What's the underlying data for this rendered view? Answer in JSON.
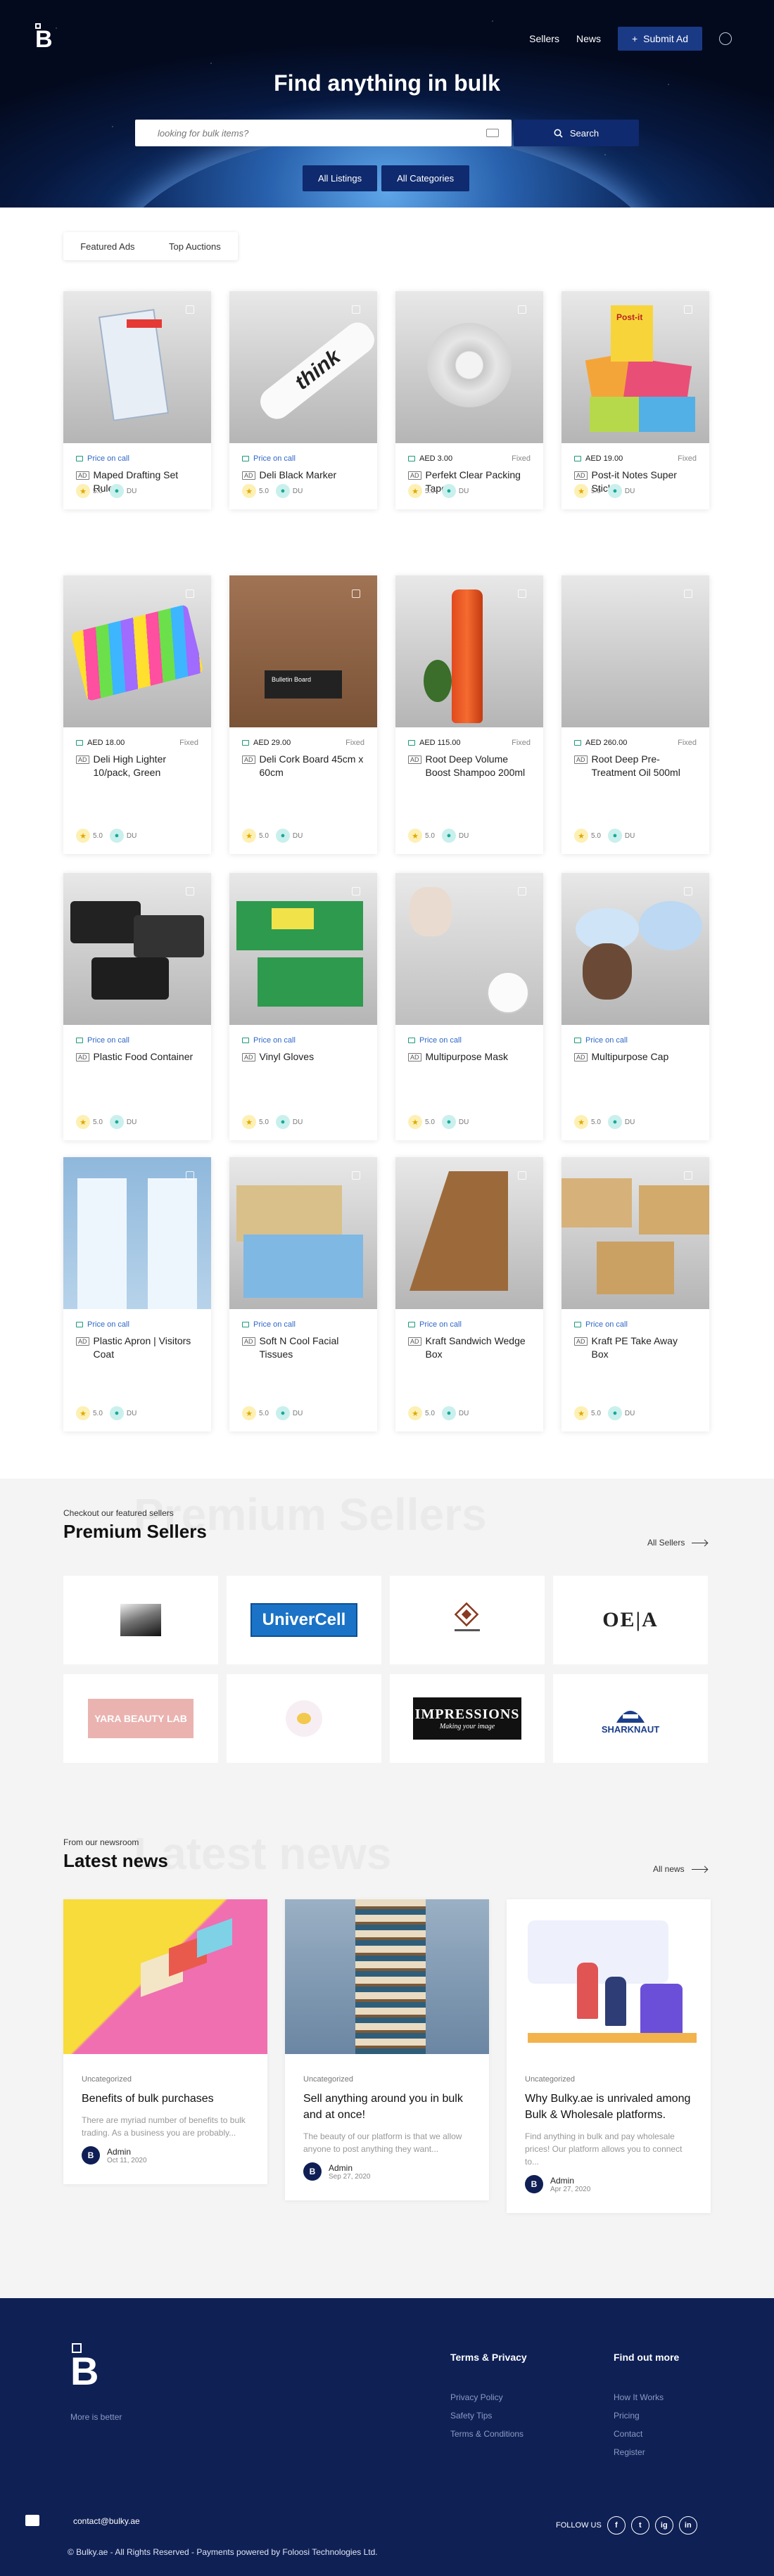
{
  "header": {
    "logo_letter": "B",
    "nav": [
      "Sellers",
      "News"
    ],
    "submit_label": "Submit Ad",
    "hero_title": "Find anything in bulk",
    "search_placeholder": "looking for bulk items?",
    "search_button": "Search",
    "hero_tabs": [
      "All Listings",
      "All Categories"
    ]
  },
  "featured_tabs": [
    "Featured Ads",
    "Top Auctions"
  ],
  "listings": [
    {
      "price": "Price on call",
      "fixed": "",
      "title": "Maped Drafting Set Rulers",
      "rating": "5.0",
      "loc": "DU"
    },
    {
      "price": "Price on call",
      "fixed": "",
      "title": "Deli Black Marker",
      "rating": "5.0",
      "loc": "DU"
    },
    {
      "price": "AED 3.00",
      "fixed": "Fixed",
      "title": "Perfekt Clear Packing Tape",
      "rating": "5.0",
      "loc": "DU"
    },
    {
      "price": "AED 19.00",
      "fixed": "Fixed",
      "title": "Post-it Notes Super Sticky",
      "rating": "5.0",
      "loc": "DU"
    },
    {
      "price": "AED 18.00",
      "fixed": "Fixed",
      "title": "Deli High Lighter 10/pack, Green",
      "rating": "5.0",
      "loc": "DU"
    },
    {
      "price": "AED 29.00",
      "fixed": "Fixed",
      "title": "Deli Cork Board 45cm x 60cm",
      "rating": "5.0",
      "loc": "DU"
    },
    {
      "price": "AED 115.00",
      "fixed": "Fixed",
      "title": "Root Deep Volume Boost Shampoo 200ml",
      "rating": "5.0",
      "loc": "DU"
    },
    {
      "price": "AED 260.00",
      "fixed": "Fixed",
      "title": "Root Deep Pre-Treatment Oil 500ml",
      "rating": "5.0",
      "loc": "DU"
    },
    {
      "price": "Price on call",
      "fixed": "",
      "title": "Plastic Food Container",
      "rating": "5.0",
      "loc": "DU"
    },
    {
      "price": "Price on call",
      "fixed": "",
      "title": "Vinyl Gloves",
      "rating": "5.0",
      "loc": "DU"
    },
    {
      "price": "Price on call",
      "fixed": "",
      "title": "Multipurpose Mask",
      "rating": "5.0",
      "loc": "DU"
    },
    {
      "price": "Price on call",
      "fixed": "",
      "title": "Multipurpose Cap",
      "rating": "5.0",
      "loc": "DU"
    },
    {
      "price": "Price on call",
      "fixed": "",
      "title": "Plastic Apron | Visitors Coat",
      "rating": "5.0",
      "loc": "DU"
    },
    {
      "price": "Price on call",
      "fixed": "",
      "title": "Soft N Cool Facial Tissues",
      "rating": "5.0",
      "loc": "DU"
    },
    {
      "price": "Price on call",
      "fixed": "",
      "title": "Kraft Sandwich Wedge Box",
      "rating": "5.0",
      "loc": "DU"
    },
    {
      "price": "Price on call",
      "fixed": "",
      "title": "Kraft PE Take Away Box",
      "rating": "5.0",
      "loc": "DU"
    }
  ],
  "ad_badge": "AD",
  "product_image_text": {
    "marker_brand": "think",
    "postit_brand": "Post-it",
    "corkboard_label": "Bulletin Board"
  },
  "sellers": {
    "kicker": "Checkout our featured sellers",
    "title": "Premium Sellers",
    "ghost": "Premium Sellers",
    "link": "All Sellers",
    "logos": [
      "",
      "UniverCell",
      "",
      "OE|A",
      "YARA BEAUTY LAB",
      "",
      "IMPRESSIONS",
      "SHARKNAUT"
    ],
    "logo_subtexts": {
      "impressions": "Making your image"
    }
  },
  "news": {
    "kicker": "From our newsroom",
    "title": "Latest news",
    "ghost": "Latest news",
    "link": "All news",
    "posts": [
      {
        "category": "Uncategorized",
        "title": "Benefits of bulk purchases",
        "excerpt": "There are myriad number of benefits to bulk trading. As a business you are probably...",
        "author": "Admin",
        "date": "Oct 11, 2020"
      },
      {
        "category": "Uncategorized",
        "title": "Sell anything around you in bulk and at once!",
        "excerpt": "The beauty of our platform is that we allow anyone to post anything they want...",
        "author": "Admin",
        "date": "Sep 27, 2020"
      },
      {
        "category": "Uncategorized",
        "title": "Why Bulky.ae is unrivaled among Bulk & Wholesale platforms.",
        "excerpt": "Find anything in bulk and pay wholesale prices! Our platform allows you to connect to...",
        "author": "Admin",
        "date": "Apr 27, 2020"
      }
    ]
  },
  "footer": {
    "logo_letter": "B",
    "tagline": "More is better",
    "col1_title": "Terms & Privacy",
    "col1_links": [
      "Privacy Policy",
      "Safety Tips",
      "Terms & Conditions"
    ],
    "col2_title": "Find out more",
    "col2_links": [
      "How It Works",
      "Pricing",
      "Contact",
      "Register"
    ],
    "email": "contact@bulky.ae",
    "copyright": "© Bulky.ae - All Rights Reserved - Payments powered by Foloosi Technologies Ltd.",
    "follow": "FOLLOW US",
    "social": [
      "f",
      "t",
      "ig",
      "in"
    ]
  },
  "colors": {
    "navy": "#0f2055",
    "accent": "#1b3a86",
    "call": "#2f67c8",
    "star": "#fdf0b5",
    "pin": "#c9f0ec"
  },
  "icons": [
    "search-icon",
    "plus-icon",
    "user-icon",
    "heart-icon",
    "tag-icon",
    "star-icon",
    "pin-icon",
    "arrow-right-icon",
    "chat-icon"
  ]
}
